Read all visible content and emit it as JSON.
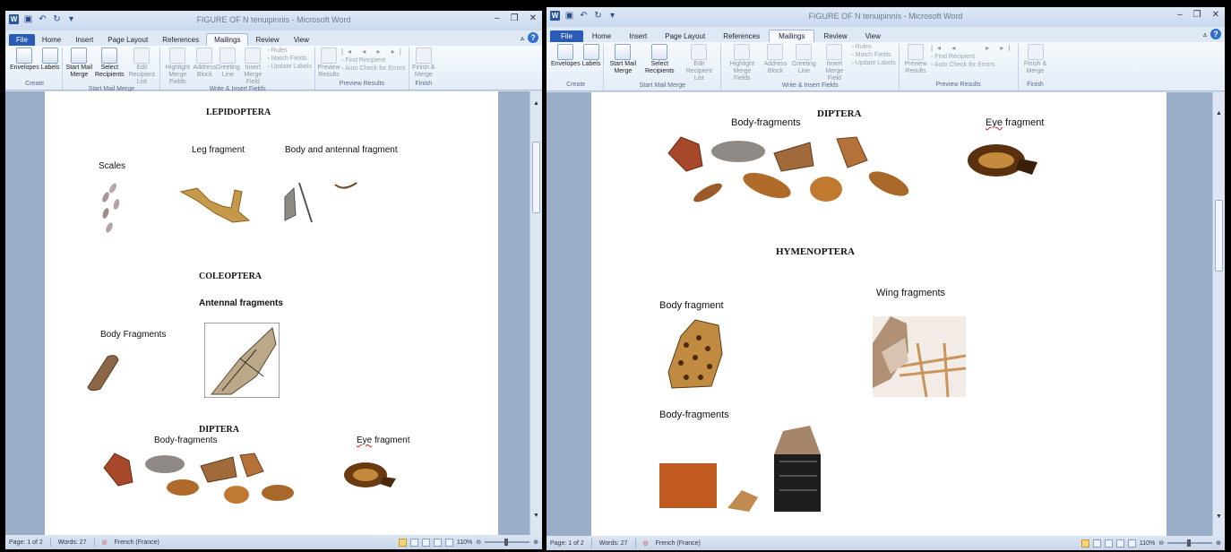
{
  "windows": [
    {
      "id": "left",
      "title": "FIGURE OF N tenuipinnis - Microsoft Word",
      "tabs": [
        "File",
        "Home",
        "Insert",
        "Page Layout",
        "References",
        "Mailings",
        "Review",
        "View"
      ],
      "active_tab": "Mailings",
      "ribbon": {
        "create": {
          "name": "Create",
          "envelopes": "Envelopes",
          "labels": "Labels"
        },
        "start": {
          "name": "Start Mail Merge",
          "start_mail_merge": "Start Mail Merge",
          "select_recipients": "Select Recipients",
          "edit_recipient_list": "Edit Recipient List"
        },
        "write": {
          "name": "Write & Insert Fields",
          "highlight": "Highlight Merge Fields",
          "address": "Address Block",
          "greeting": "Greeting Line",
          "insert_merge": "Insert Merge Field",
          "rules": "Rules",
          "match": "Match Fields",
          "update": "Update Labels"
        },
        "preview": {
          "name": "Preview Results",
          "preview_results": "Preview Results",
          "find": "Find Recipient",
          "auto_check": "Auto Check for Errors"
        },
        "finish": {
          "name": "Finish",
          "finish_merge": "Finish & Merge"
        }
      },
      "status": {
        "page": "Page: 1 of 2",
        "words": "Words: 27",
        "language": "French (France)",
        "zoom": "110%"
      },
      "document": {
        "lepidoptera": "LEPIDOPTERA",
        "leg_fragment": "Leg fragment",
        "body_antennal": "Body and antennal fragment",
        "scales": "Scales",
        "coleoptera": "COLEOPTERA",
        "antennal_fragments": "Antennal fragments",
        "body_fragments": "Body Fragments",
        "diptera": "DIPTERA",
        "body_fragments2": "Body-fragments",
        "eye_fragment": "Eye fragment"
      }
    },
    {
      "id": "right",
      "title": "FIGURE OF N tenuipinnis - Microsoft Word",
      "tabs": [
        "File",
        "Home",
        "Insert",
        "Page Layout",
        "References",
        "Mailings",
        "Review",
        "View"
      ],
      "active_tab": "Mailings",
      "ribbon": {
        "create": {
          "name": "Create",
          "envelopes": "Envelopes",
          "labels": "Labels"
        },
        "start": {
          "name": "Start Mail Merge",
          "start_mail_merge": "Start Mail Merge",
          "select_recipients": "Select Recipients",
          "edit_recipient_list": "Edit Recipient List"
        },
        "write": {
          "name": "Write & Insert Fields",
          "highlight": "Highlight Merge Fields",
          "address": "Address Block",
          "greeting": "Greeting Line",
          "insert_merge": "Insert Merge Field",
          "rules": "Rules",
          "match": "Match Fields",
          "update": "Update Labels"
        },
        "preview": {
          "name": "Preview Results",
          "preview_results": "Preview Results",
          "find": "Find Recipient",
          "auto_check": "Auto Check for Errors"
        },
        "finish": {
          "name": "Finish",
          "finish_merge": "Finish & Merge"
        }
      },
      "status": {
        "page": "Page: 1 of 2",
        "words": "Words: 27",
        "language": "French (France)",
        "zoom": "110%"
      },
      "document": {
        "diptera": "DIPTERA",
        "body_fragments": "Body-fragments",
        "eye_fragment": "Eye fragment",
        "hymenoptera": "HYMENOPTERA",
        "body_fragment": "Body fragment",
        "wing_fragments": "Wing fragments",
        "body_fragments2": "Body-fragments"
      }
    }
  ],
  "colors": {
    "file_tab": "#2b5cb5",
    "title_bar": "#dfe9f6",
    "doc_background": "#9aaec8",
    "status_bar": "#c6d5ea"
  }
}
